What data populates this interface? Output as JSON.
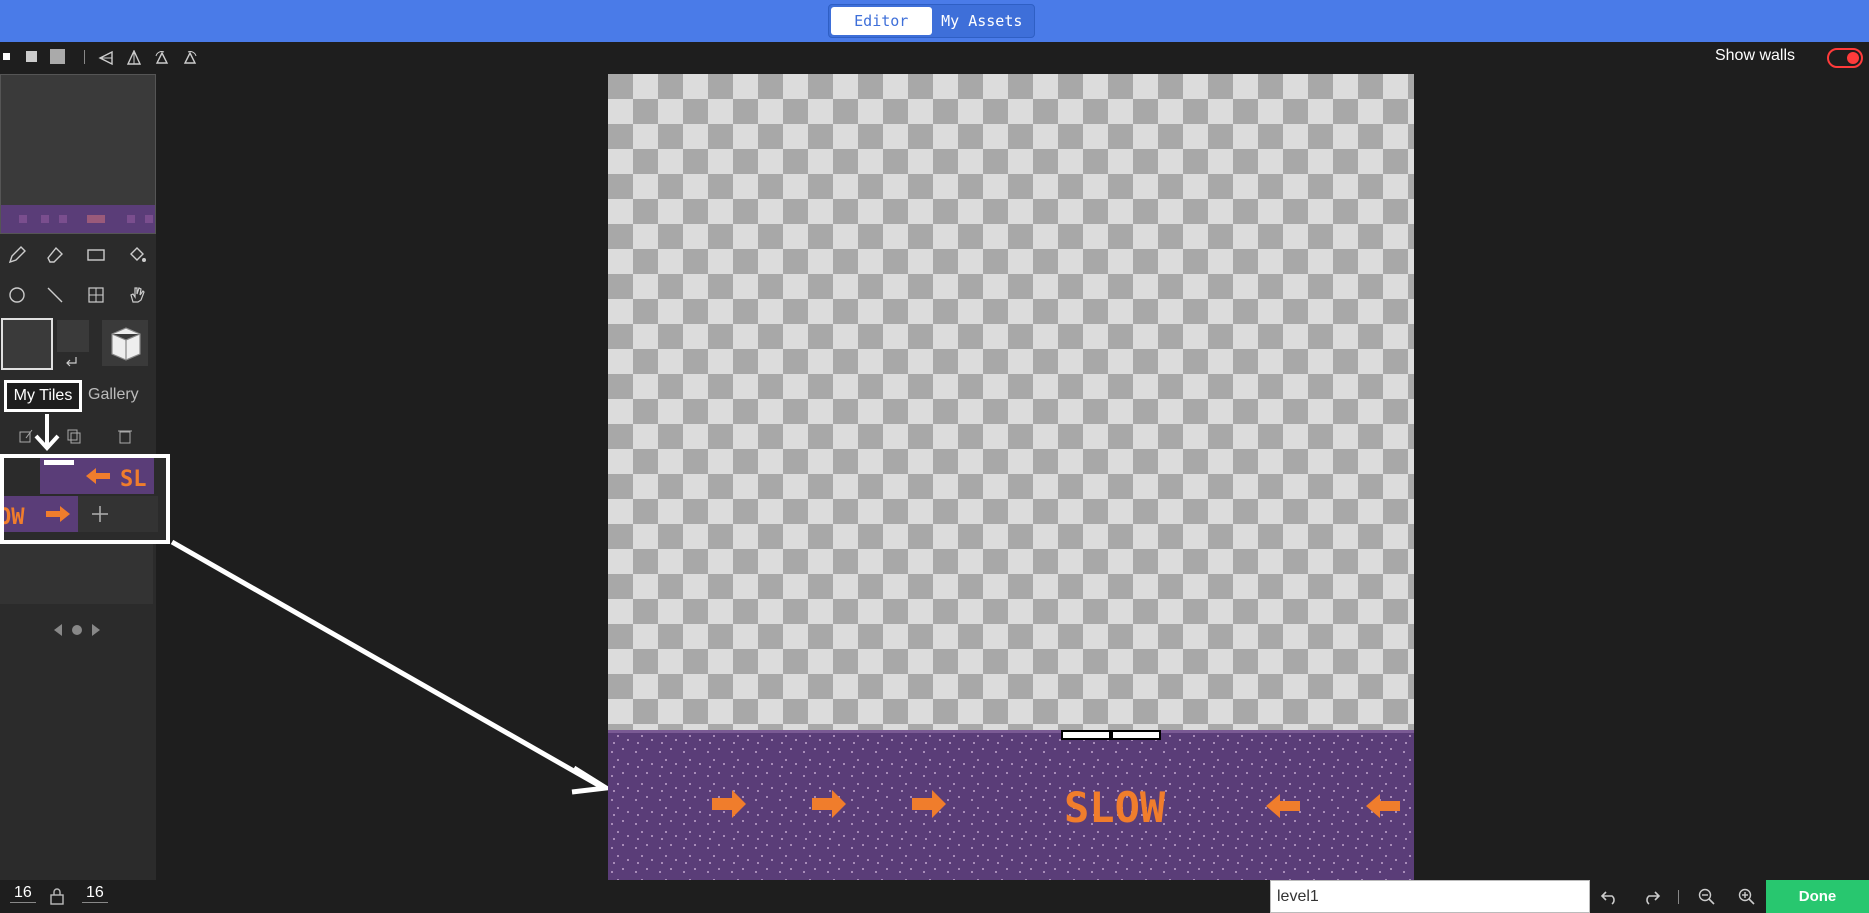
{
  "top_tabs": {
    "editor": "Editor",
    "my_assets": "My Assets"
  },
  "toolbar": {
    "show_walls_label": "Show walls",
    "show_walls_on": true
  },
  "sidebar": {
    "tabs": {
      "my_tiles": "My Tiles",
      "gallery": "Gallery"
    },
    "tiles_preview": {
      "tile_text_1": "SL",
      "tile_text_2": "OW"
    }
  },
  "canvas": {
    "banner_text": "SLOW"
  },
  "bottom": {
    "width_value": "16",
    "height_value": "16",
    "level_name": "level1",
    "done_label": "Done"
  },
  "colors": {
    "topbar": "#4a7be8",
    "tile_purple": "#5a3d78",
    "tile_orange": "#f07d2c",
    "done_green": "#28c76f",
    "toggle_red": "#ff3b3b"
  }
}
